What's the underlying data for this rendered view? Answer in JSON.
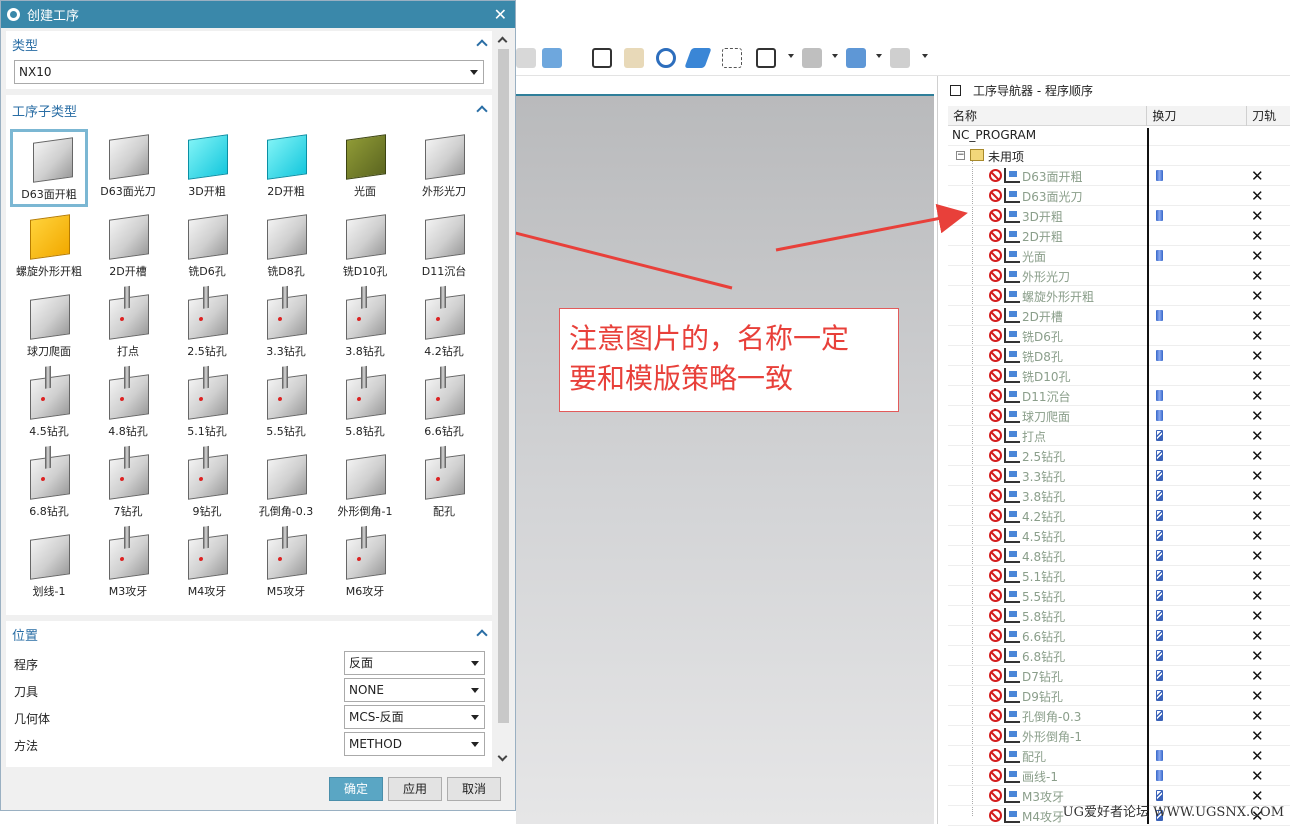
{
  "dialog": {
    "title": "创建工序",
    "type_section": {
      "title": "类型",
      "value": "NX10"
    },
    "subtype_section": {
      "title": "工序子类型",
      "tiles": [
        {
          "label": "D63面开粗",
          "style": "face",
          "selected": true
        },
        {
          "label": "D63面光刀",
          "style": "face"
        },
        {
          "label": "3D开粗",
          "style": "cyan"
        },
        {
          "label": "2D开粗",
          "style": "cyan"
        },
        {
          "label": "光面",
          "style": "olive"
        },
        {
          "label": "外形光刀",
          "style": "grey"
        },
        {
          "label": "螺旋外形开粗",
          "style": "yel"
        },
        {
          "label": "2D开槽",
          "style": "grey"
        },
        {
          "label": "铣D6孔",
          "style": "grey"
        },
        {
          "label": "铣D8孔",
          "style": "grey"
        },
        {
          "label": "铣D10孔",
          "style": "grey"
        },
        {
          "label": "D11沉台",
          "style": "grey"
        },
        {
          "label": "球刀爬面",
          "style": "grey"
        },
        {
          "label": "打点",
          "style": "drill"
        },
        {
          "label": "2.5钻孔",
          "style": "drill"
        },
        {
          "label": "3.3钻孔",
          "style": "drill"
        },
        {
          "label": "3.8钻孔",
          "style": "drill"
        },
        {
          "label": "4.2钻孔",
          "style": "drill"
        },
        {
          "label": "4.5钻孔",
          "style": "drill"
        },
        {
          "label": "4.8钻孔",
          "style": "drill"
        },
        {
          "label": "5.1钻孔",
          "style": "drill"
        },
        {
          "label": "5.5钻孔",
          "style": "drill"
        },
        {
          "label": "5.8钻孔",
          "style": "drill"
        },
        {
          "label": "6.6钻孔",
          "style": "drill"
        },
        {
          "label": "6.8钻孔",
          "style": "drill"
        },
        {
          "label": "7钻孔",
          "style": "drill"
        },
        {
          "label": "9钻孔",
          "style": "drill"
        },
        {
          "label": "孔倒角-0.3",
          "style": "grey"
        },
        {
          "label": "外形倒角-1",
          "style": "grey"
        },
        {
          "label": "配孔",
          "style": "drill"
        },
        {
          "label": "划线-1",
          "style": "grey"
        },
        {
          "label": "M3攻牙",
          "style": "drill"
        },
        {
          "label": "M4攻牙",
          "style": "drill"
        },
        {
          "label": "M5攻牙",
          "style": "drill"
        },
        {
          "label": "M6攻牙",
          "style": "drill"
        }
      ]
    },
    "location_section": {
      "title": "位置",
      "program_label": "程序",
      "program_value": "反面",
      "tool_label": "刀具",
      "tool_value": "NONE",
      "geometry_label": "几何体",
      "geometry_value": "MCS-反面",
      "method_label": "方法",
      "method_value": "METHOD"
    },
    "buttons": {
      "ok": "确定",
      "apply": "应用",
      "cancel": "取消"
    }
  },
  "navigator": {
    "title": "工序导航器 - 程序顺序",
    "columns": [
      "名称",
      "换刀",
      "刀轨"
    ],
    "root": "NC_PROGRAM",
    "group": "未用项",
    "ops": [
      {
        "name": "D63面开粗",
        "tool": "b"
      },
      {
        "name": "D63面光刀",
        "tool": ""
      },
      {
        "name": "3D开粗",
        "tool": "b"
      },
      {
        "name": "2D开粗",
        "tool": ""
      },
      {
        "name": "光面",
        "tool": "b"
      },
      {
        "name": "外形光刀",
        "tool": ""
      },
      {
        "name": "螺旋外形开粗",
        "tool": ""
      },
      {
        "name": "2D开槽",
        "tool": "b"
      },
      {
        "name": "铣D6孔",
        "tool": ""
      },
      {
        "name": "铣D8孔",
        "tool": "b"
      },
      {
        "name": "铣D10孔",
        "tool": ""
      },
      {
        "name": "D11沉台",
        "tool": "b"
      },
      {
        "name": "球刀爬面",
        "tool": "b"
      },
      {
        "name": "打点",
        "tool": "d"
      },
      {
        "name": "2.5钻孔",
        "tool": "d"
      },
      {
        "name": "3.3钻孔",
        "tool": "d"
      },
      {
        "name": "3.8钻孔",
        "tool": "d"
      },
      {
        "name": "4.2钻孔",
        "tool": "d"
      },
      {
        "name": "4.5钻孔",
        "tool": "d"
      },
      {
        "name": "4.8钻孔",
        "tool": "d"
      },
      {
        "name": "5.1钻孔",
        "tool": "d"
      },
      {
        "name": "5.5钻孔",
        "tool": "d"
      },
      {
        "name": "5.8钻孔",
        "tool": "d"
      },
      {
        "name": "6.6钻孔",
        "tool": "d"
      },
      {
        "name": "6.8钻孔",
        "tool": "d"
      },
      {
        "name": "D7钻孔",
        "tool": "d"
      },
      {
        "name": "D9钻孔",
        "tool": "d"
      },
      {
        "name": "孔倒角-0.3",
        "tool": "d"
      },
      {
        "name": "外形倒角-1",
        "tool": ""
      },
      {
        "name": "配孔",
        "tool": "b"
      },
      {
        "name": "画线-1",
        "tool": "b"
      },
      {
        "name": "M3攻牙",
        "tool": "d"
      },
      {
        "name": "M4攻牙",
        "tool": "d"
      }
    ],
    "path_mark": "✕"
  },
  "annotation": {
    "line1": "注意图片的，名称一定",
    "line2": "要和模版策略一致"
  },
  "watermark": "UG爱好者论坛 WWW.UGSNX.COM",
  "colors": {
    "title_bar": "#3a88aa",
    "section_title": "#2a6ea5",
    "annotation_red": "#e8403a"
  }
}
